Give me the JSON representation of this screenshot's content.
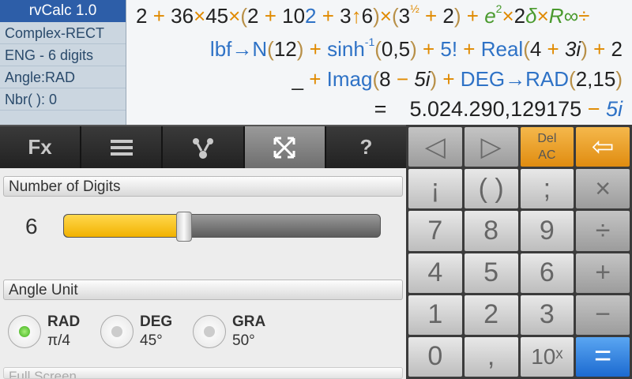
{
  "info": {
    "title": "rvCalc 1.0",
    "lines": [
      "Complex-RECT",
      "ENG - 6 digits",
      "Angle:RAD",
      "Nbr( ): 0"
    ]
  },
  "expression": {
    "line1": [
      {
        "t": "2",
        "c": "num"
      },
      {
        "t": " + ",
        "c": "op"
      },
      {
        "t": "36",
        "c": "num"
      },
      {
        "t": "×",
        "c": "op"
      },
      {
        "t": "45",
        "c": "num"
      },
      {
        "t": "×",
        "c": "op"
      },
      {
        "t": "(",
        "c": "par"
      },
      {
        "t": "2",
        "c": "num"
      },
      {
        "t": " + ",
        "c": "op"
      },
      {
        "t": "10",
        "c": "num"
      },
      {
        "t": "2",
        "c": "fn"
      },
      {
        "t": " + ",
        "c": "op"
      },
      {
        "t": "3",
        "c": "num"
      },
      {
        "t": "↑",
        "c": "op"
      },
      {
        "t": "6",
        "c": "num"
      },
      {
        "t": ")",
        "c": "par"
      },
      {
        "t": "×",
        "c": "op"
      },
      {
        "t": "(",
        "c": "par"
      },
      {
        "t": "3",
        "c": "num"
      },
      {
        "t": "½",
        "c": "op",
        "sup": true
      },
      {
        "t": " + ",
        "c": "op"
      },
      {
        "t": "2",
        "c": "num"
      },
      {
        "t": ")",
        "c": "par"
      },
      {
        "t": " + ",
        "c": "op"
      },
      {
        "t": "e",
        "c": "grn",
        "i": true
      },
      {
        "t": "2",
        "c": "grn",
        "sup": true
      },
      {
        "t": "×",
        "c": "op"
      },
      {
        "t": "2",
        "c": "num"
      },
      {
        "t": "δ",
        "c": "grn",
        "i": true
      },
      {
        "t": "×",
        "c": "op"
      },
      {
        "t": "R",
        "c": "grn",
        "i": true
      },
      {
        "t": "∞",
        "c": "grn",
        "i": true
      },
      {
        "t": "÷",
        "c": "op"
      }
    ],
    "line2": [
      {
        "t": "lbf→N",
        "c": "fn"
      },
      {
        "t": "(",
        "c": "par"
      },
      {
        "t": "12",
        "c": "num"
      },
      {
        "t": ")",
        "c": "par"
      },
      {
        "t": " + ",
        "c": "op"
      },
      {
        "t": "sinh",
        "c": "fn"
      },
      {
        "t": "-1",
        "c": "fn",
        "sup": true
      },
      {
        "t": "(",
        "c": "par"
      },
      {
        "t": "0,5",
        "c": "num"
      },
      {
        "t": ")",
        "c": "par"
      },
      {
        "t": " + ",
        "c": "op"
      },
      {
        "t": "5!",
        "c": "fn"
      },
      {
        "t": " + ",
        "c": "op"
      },
      {
        "t": "Real",
        "c": "fn"
      },
      {
        "t": "(",
        "c": "par"
      },
      {
        "t": "4",
        "c": "num"
      },
      {
        "t": " + ",
        "c": "op"
      },
      {
        "t": "3i",
        "c": "num",
        "i": true
      },
      {
        "t": ")",
        "c": "par"
      },
      {
        "t": " + ",
        "c": "op"
      },
      {
        "t": "2",
        "c": "num"
      }
    ],
    "line3": [
      {
        "t": "_",
        "c": "num"
      },
      {
        "t": " + ",
        "c": "op"
      },
      {
        "t": "Imag",
        "c": "fn"
      },
      {
        "t": "(",
        "c": "par"
      },
      {
        "t": "8",
        "c": "num"
      },
      {
        "t": " − ",
        "c": "op"
      },
      {
        "t": "5i",
        "c": "num",
        "i": true
      },
      {
        "t": ")",
        "c": "par"
      },
      {
        "t": " + ",
        "c": "op"
      },
      {
        "t": "DEG→RAD",
        "c": "fn"
      },
      {
        "t": "(",
        "c": "par"
      },
      {
        "t": "2,15",
        "c": "num"
      },
      {
        "t": ")",
        "c": "par"
      }
    ],
    "result_prefix": "=",
    "result_real": "5.024.290,129175",
    "result_sep": " − ",
    "result_imag": "5i"
  },
  "toolbar": {
    "fx_label": "Fx",
    "menu_icon": "menu-icon",
    "functions_icon": "functions-icon",
    "fullscreen_icon": "fullscreen-icon",
    "help_label": "?"
  },
  "settings": {
    "digits_header": "Number of Digits",
    "digits_value": "6",
    "digits_fraction": 0.38,
    "angle_header": "Angle Unit",
    "angle_options": [
      {
        "label": "RAD",
        "sub": "π/4",
        "selected": true
      },
      {
        "label": "DEG",
        "sub": "45°",
        "selected": false
      },
      {
        "label": "GRA",
        "sub": "50°",
        "selected": false
      }
    ],
    "next_section_hint": "Full Screen ..."
  },
  "keypad": {
    "keys": [
      {
        "label": "◁",
        "name": "cursor-left-key",
        "style": "gray"
      },
      {
        "label": "▷",
        "name": "cursor-right-key",
        "style": "gray"
      },
      {
        "label": "Del\nAC",
        "name": "delete-clear-key",
        "style": "orange del"
      },
      {
        "label": "⇦",
        "name": "backspace-key",
        "style": "orange"
      },
      {
        "label": "¡",
        "name": "factorial-key",
        "style": ""
      },
      {
        "label": "( )",
        "name": "parentheses-key",
        "style": ""
      },
      {
        "label": ";",
        "name": "separator-key",
        "style": ""
      },
      {
        "label": "×",
        "name": "multiply-key",
        "style": "gray"
      },
      {
        "label": "7",
        "name": "key-7",
        "style": ""
      },
      {
        "label": "8",
        "name": "key-8",
        "style": ""
      },
      {
        "label": "9",
        "name": "key-9",
        "style": ""
      },
      {
        "label": "÷",
        "name": "divide-key",
        "style": "gray"
      },
      {
        "label": "4",
        "name": "key-4",
        "style": ""
      },
      {
        "label": "5",
        "name": "key-5",
        "style": ""
      },
      {
        "label": "6",
        "name": "key-6",
        "style": ""
      },
      {
        "label": "+",
        "name": "plus-key",
        "style": "gray"
      },
      {
        "label": "1",
        "name": "key-1",
        "style": ""
      },
      {
        "label": "2",
        "name": "key-2",
        "style": ""
      },
      {
        "label": "3",
        "name": "key-3",
        "style": ""
      },
      {
        "label": "−",
        "name": "minus-key",
        "style": "gray"
      },
      {
        "label": "0",
        "name": "key-0",
        "style": ""
      },
      {
        "label": ",",
        "name": "decimal-key",
        "style": ""
      },
      {
        "label": "10ˣ",
        "name": "power10-key",
        "style": "small"
      },
      {
        "label": "=",
        "name": "equals-key",
        "style": "blue"
      }
    ]
  },
  "colors": {
    "accent": "#2d5ea8",
    "orange": "#e08c10",
    "blue": "#1c6ad0",
    "slider": "#f2b200"
  }
}
